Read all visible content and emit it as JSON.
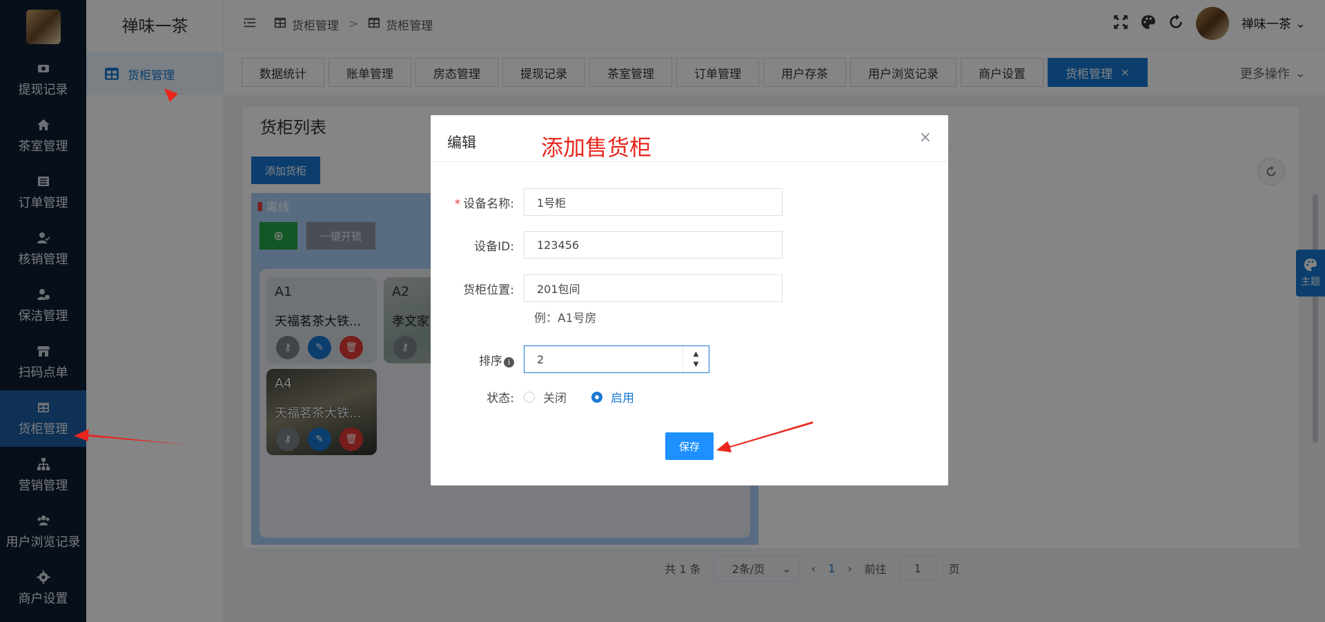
{
  "app": {
    "brand": "禅味一茶",
    "username": "禅味一茶"
  },
  "leftnav": {
    "items": [
      {
        "label": "提现记录",
        "icon": "camera-icon"
      },
      {
        "label": "茶室管理",
        "icon": "home-icon"
      },
      {
        "label": "订单管理",
        "icon": "list-icon"
      },
      {
        "label": "核销管理",
        "icon": "user-check-icon"
      },
      {
        "label": "保洁管理",
        "icon": "user-clock-icon"
      },
      {
        "label": "扫码点单",
        "icon": "store-icon"
      },
      {
        "label": "货柜管理",
        "icon": "table-icon",
        "active": true
      },
      {
        "label": "营销管理",
        "icon": "sitemap-icon"
      },
      {
        "label": "用户浏览记录",
        "icon": "users-icon"
      },
      {
        "label": "商户设置",
        "icon": "gear-icon"
      }
    ]
  },
  "submenu": {
    "item": "货柜管理"
  },
  "breadcrumb": {
    "level1": "货柜管理",
    "sep": ">",
    "level2": "货柜管理"
  },
  "tabs": [
    {
      "label": "数据统计"
    },
    {
      "label": "账单管理"
    },
    {
      "label": "房态管理"
    },
    {
      "label": "提现记录"
    },
    {
      "label": "茶室管理"
    },
    {
      "label": "订单管理"
    },
    {
      "label": "用户存茶"
    },
    {
      "label": "用户浏览记录"
    },
    {
      "label": "商户设置"
    },
    {
      "label": "货柜管理",
      "active": true,
      "close": "×"
    }
  ],
  "more_ops": "更多操作",
  "page": {
    "title": "货柜列表",
    "add_button": "添加货柜",
    "cabinet": {
      "status": "离线",
      "green_button": "⊕",
      "unlock_all": "一键开锁",
      "slots": [
        {
          "name": "A1",
          "desc": "天福茗茶大铁..."
        },
        {
          "name": "A2",
          "desc": "孝文家..."
        },
        {
          "name": "A4",
          "desc": "天福茗茶大铁..."
        }
      ]
    },
    "pagination": {
      "total": "共 1 条",
      "page_size": "2条/页",
      "prev": "‹",
      "current": "1",
      "next": "›",
      "goto_label": "前往",
      "goto_value": "1",
      "page_unit": "页"
    }
  },
  "theme_button": "主题",
  "dialog": {
    "title": "编辑",
    "annotation": "添加售货柜",
    "close": "×",
    "fields": {
      "device_name": {
        "label": "设备名称:",
        "required": "*",
        "value": "1号柜"
      },
      "device_id": {
        "label": "设备ID:",
        "value": "123456"
      },
      "location": {
        "label": "货柜位置:",
        "value": "201包间",
        "hint": "例：A1号房"
      },
      "sort": {
        "label": "排序",
        "info": "i",
        "value": "2"
      },
      "status": {
        "label": "状态:",
        "off": "关闭",
        "on": "启用",
        "selected": "启用"
      }
    },
    "save": "保存"
  },
  "colors": {
    "primary": "#1677d2",
    "sidebar": "#0f1d33",
    "danger": "#e53935",
    "success": "#24a84a",
    "annotation": "#e8261e"
  }
}
